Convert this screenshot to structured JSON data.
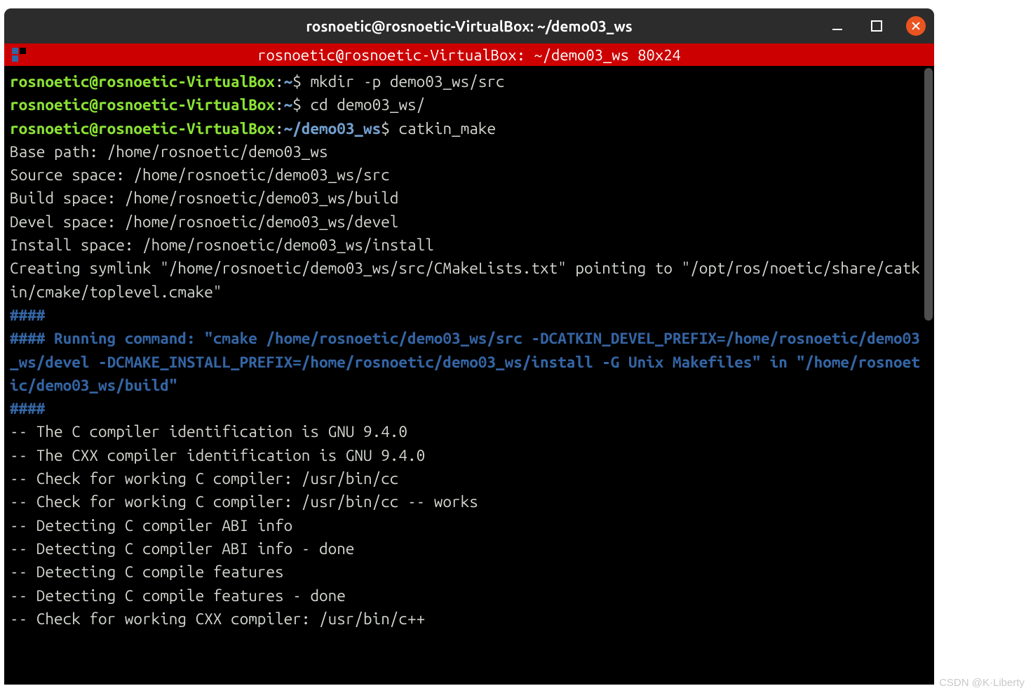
{
  "window": {
    "title": "rosnoetic@rosnoetic-VirtualBox: ~/demo03_ws"
  },
  "redbar": {
    "text": "rosnoetic@rosnoetic-VirtualBox: ~/demo03_ws 80x24"
  },
  "prompt": {
    "userhost": "rosnoetic@rosnoetic-VirtualBox",
    "sep": ":",
    "tilde": "~",
    "dollar": "$ ",
    "cwd": "~/demo03_ws"
  },
  "commands": {
    "c1": "mkdir -p demo03_ws/src",
    "c2": "cd demo03_ws/",
    "c3": "catkin_make"
  },
  "output": {
    "l1": "Base path: /home/rosnoetic/demo03_ws",
    "l2": "Source space: /home/rosnoetic/demo03_ws/src",
    "l3": "Build space: /home/rosnoetic/demo03_ws/build",
    "l4": "Devel space: /home/rosnoetic/demo03_ws/devel",
    "l5": "Install space: /home/rosnoetic/demo03_ws/install",
    "l6": "Creating symlink \"/home/rosnoetic/demo03_ws/src/CMakeLists.txt\" pointing to \"/opt/ros/noetic/share/catkin/cmake/toplevel.cmake\"",
    "h1": "####",
    "h2a": "#### Running command: ",
    "h2b": "\"cmake /home/rosnoetic/demo03_ws/src -DCATKIN_DEVEL_PREFIX=/home/rosnoetic/demo03_ws/devel -DCMAKE_INSTALL_PREFIX=/home/rosnoetic/demo03_ws/install -G Unix Makefiles\"",
    "h2c": " in ",
    "h2d": "\"/home/rosnoetic/demo03_ws/build\"",
    "h3": "####",
    "l7": "-- The C compiler identification is GNU 9.4.0",
    "l8": "-- The CXX compiler identification is GNU 9.4.0",
    "l9": "-- Check for working C compiler: /usr/bin/cc",
    "l10": "-- Check for working C compiler: /usr/bin/cc -- works",
    "l11": "-- Detecting C compiler ABI info",
    "l12": "-- Detecting C compiler ABI info - done",
    "l13": "-- Detecting C compile features",
    "l14": "-- Detecting C compile features - done",
    "l15": "-- Check for working CXX compiler: /usr/bin/c++"
  },
  "watermark": "CSDN @K·Liberty"
}
